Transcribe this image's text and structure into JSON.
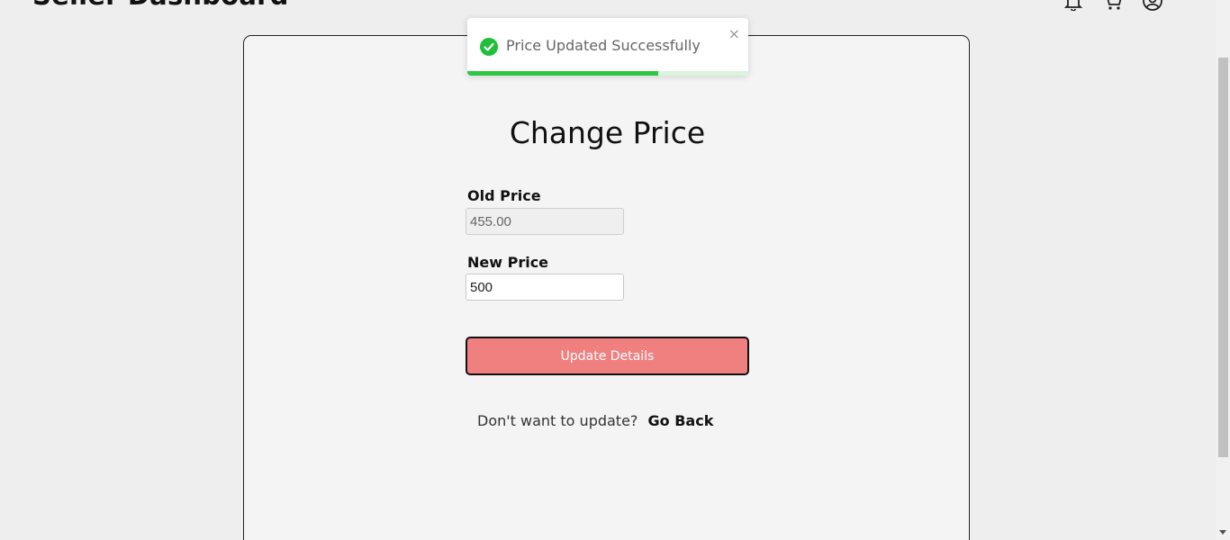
{
  "header": {
    "title": "Seller Dashboard",
    "icons": [
      "bell-icon",
      "cart-icon",
      "user-account-icon"
    ]
  },
  "form": {
    "title": "Change Price",
    "old_price_label": "Old Price",
    "old_price_value": "455.00",
    "new_price_label": "New Price",
    "new_price_value": "500",
    "submit_label": "Update Details",
    "back_prompt": "Don't want to update?",
    "back_link": "Go Back"
  },
  "toast": {
    "message": "Price Updated Successfully",
    "close_symbol": "×",
    "progress": 0.68,
    "accent_color": "#2ec642"
  },
  "colors": {
    "button_bg": "#f08080",
    "card_bg": "#f4f4f4",
    "page_bg": "#eeeeee"
  }
}
